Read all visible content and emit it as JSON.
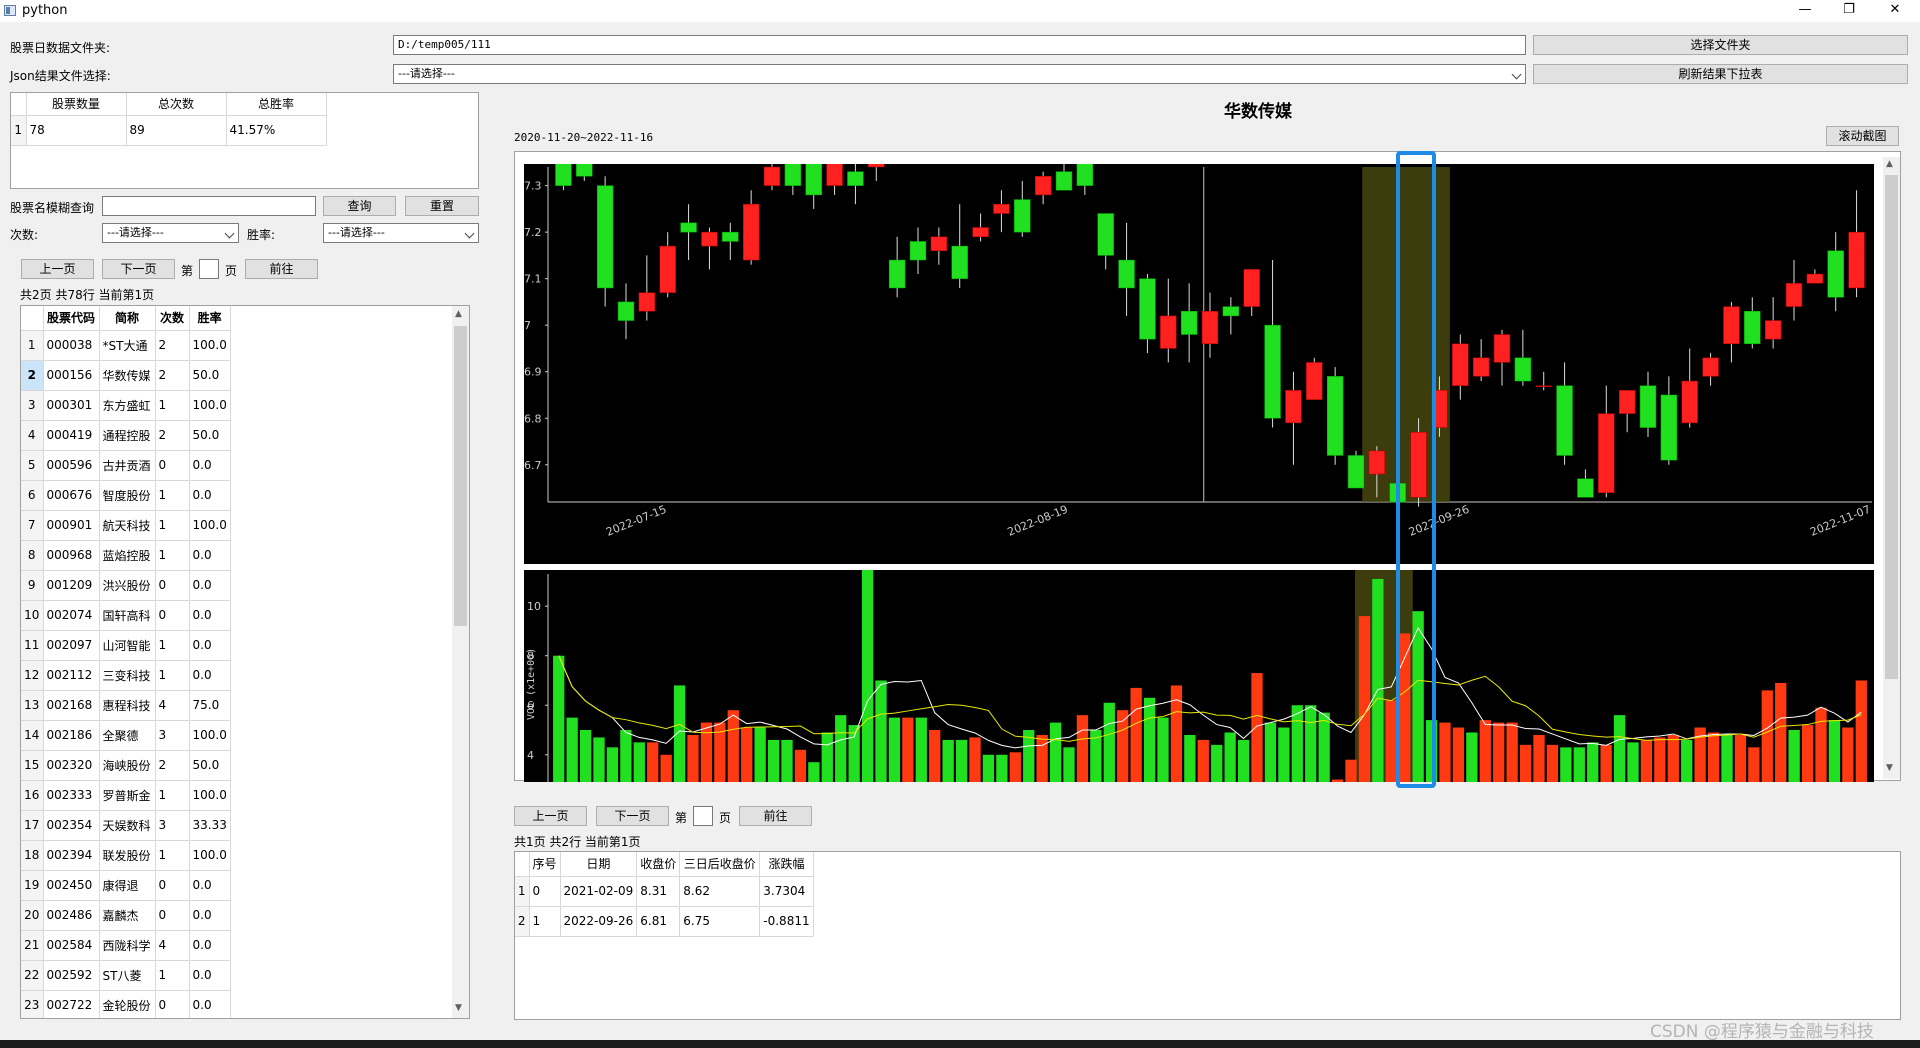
{
  "window": {
    "title": "python",
    "minimize": "—",
    "maximize": "❐",
    "close": "✕"
  },
  "folder": {
    "label": "股票日数据文件夹:",
    "value": "D:/temp005/111",
    "button": "选择文件夹"
  },
  "json": {
    "label": "Json结果文件选择:",
    "value": "---请选择---",
    "button": "刷新结果下拉表"
  },
  "summary": {
    "headers": [
      "股票数量",
      "总次数",
      "总胜率"
    ],
    "row_num": "1",
    "values": [
      "78",
      "89",
      "41.57%"
    ]
  },
  "search": {
    "label": "股票名模糊查询",
    "value": "",
    "query_button": "查询",
    "reset_button": "重置"
  },
  "filters": {
    "count_label": "次数:",
    "count_value": "---请选择---",
    "rate_label": "胜率:",
    "rate_value": "---请选择---"
  },
  "pager_left": {
    "prev": "上一页",
    "next": "下一页",
    "di": "第",
    "ye": "页",
    "go": "前往",
    "info": "共2页 共78行 当前第1页"
  },
  "stock_table": {
    "headers": [
      "股票代码",
      "简称",
      "次数",
      "胜率"
    ],
    "selected_row": 2,
    "rows": [
      [
        "1",
        "000038",
        "*ST大通",
        "2",
        "100.0"
      ],
      [
        "2",
        "000156",
        "华数传媒",
        "2",
        "50.0"
      ],
      [
        "3",
        "000301",
        "东方盛虹",
        "1",
        "100.0"
      ],
      [
        "4",
        "000419",
        "通程控股",
        "2",
        "50.0"
      ],
      [
        "5",
        "000596",
        "古井贡酒",
        "0",
        "0.0"
      ],
      [
        "6",
        "000676",
        "智度股份",
        "1",
        "0.0"
      ],
      [
        "7",
        "000901",
        "航天科技",
        "1",
        "100.0"
      ],
      [
        "8",
        "000968",
        "蓝焰控股",
        "1",
        "0.0"
      ],
      [
        "9",
        "001209",
        "洪兴股份",
        "0",
        "0.0"
      ],
      [
        "10",
        "002074",
        "国轩高科",
        "0",
        "0.0"
      ],
      [
        "11",
        "002097",
        "山河智能",
        "1",
        "0.0"
      ],
      [
        "12",
        "002112",
        "三变科技",
        "1",
        "0.0"
      ],
      [
        "13",
        "002168",
        "惠程科技",
        "4",
        "75.0"
      ],
      [
        "14",
        "002186",
        "全聚德",
        "3",
        "100.0"
      ],
      [
        "15",
        "002320",
        "海峡股份",
        "2",
        "50.0"
      ],
      [
        "16",
        "002333",
        "罗普斯金",
        "1",
        "100.0"
      ],
      [
        "17",
        "002354",
        "天娱数科",
        "3",
        "33.33"
      ],
      [
        "18",
        "002394",
        "联发股份",
        "1",
        "100.0"
      ],
      [
        "19",
        "002450",
        "康得退",
        "0",
        "0.0"
      ],
      [
        "20",
        "002486",
        "嘉麟杰",
        "0",
        "0.0"
      ],
      [
        "21",
        "002584",
        "西陇科学",
        "4",
        "0.0"
      ],
      [
        "22",
        "002592",
        "ST八菱",
        "1",
        "0.0"
      ],
      [
        "23",
        "002722",
        "金轮股份",
        "0",
        "0.0"
      ]
    ]
  },
  "chart_header": {
    "title": "华数传媒",
    "date_range": "2020-11-20~2022-11-16",
    "scroll_button": "滚动截图"
  },
  "chart_data": [
    {
      "type": "candlestick",
      "yticks": [
        "7.3",
        "7.2",
        "7.1",
        "7",
        "6.9",
        "6.8",
        "6.7"
      ],
      "ylim": [
        6.62,
        7.34
      ],
      "xticks": [
        "2022-07-15",
        "2022-08-19",
        "2022-09-26",
        "2022-11-07"
      ],
      "highlight": "2022-09-26",
      "candles_ohlc": [
        [
          7.35,
          7.3,
          7.35,
          7.29
        ],
        [
          7.35,
          7.32,
          7.36,
          7.31
        ],
        [
          7.3,
          7.08,
          7.32,
          7.04
        ],
        [
          7.05,
          7.01,
          7.09,
          6.97
        ],
        [
          7.03,
          7.07,
          7.15,
          7.01
        ],
        [
          7.07,
          7.17,
          7.2,
          7.06
        ],
        [
          7.22,
          7.2,
          7.26,
          7.14
        ],
        [
          7.17,
          7.2,
          7.21,
          7.12
        ],
        [
          7.2,
          7.18,
          7.22,
          7.14
        ],
        [
          7.14,
          7.26,
          7.29,
          7.13
        ],
        [
          7.3,
          7.34,
          7.38,
          7.29
        ],
        [
          7.35,
          7.3,
          7.38,
          7.28
        ],
        [
          7.35,
          7.28,
          7.36,
          7.25
        ],
        [
          7.3,
          7.35,
          7.4,
          7.28
        ],
        [
          7.33,
          7.3,
          7.36,
          7.26
        ],
        [
          7.34,
          7.35,
          7.39,
          7.31
        ],
        [
          7.14,
          7.08,
          7.19,
          7.06
        ],
        [
          7.18,
          7.14,
          7.21,
          7.11
        ],
        [
          7.16,
          7.19,
          7.21,
          7.13
        ],
        [
          7.17,
          7.1,
          7.26,
          7.08
        ],
        [
          7.19,
          7.21,
          7.24,
          7.18
        ],
        [
          7.24,
          7.26,
          7.29,
          7.2
        ],
        [
          7.27,
          7.2,
          7.31,
          7.19
        ],
        [
          7.28,
          7.32,
          7.33,
          7.26
        ],
        [
          7.33,
          7.29,
          7.35,
          7.29
        ],
        [
          7.36,
          7.3,
          7.38,
          7.28
        ],
        [
          7.24,
          7.15,
          7.24,
          7.12
        ],
        [
          7.14,
          7.08,
          7.22,
          7.02
        ],
        [
          7.1,
          6.97,
          7.11,
          6.94
        ],
        [
          6.95,
          7.02,
          7.1,
          6.92
        ],
        [
          7.03,
          6.98,
          7.09,
          6.92
        ],
        [
          6.96,
          7.03,
          7.07,
          6.93
        ],
        [
          7.04,
          7.02,
          7.06,
          6.98
        ],
        [
          7.04,
          7.12,
          7.12,
          7.02
        ],
        [
          7.0,
          6.8,
          7.14,
          6.78
        ],
        [
          6.79,
          6.86,
          6.9,
          6.7
        ],
        [
          6.84,
          6.92,
          6.93,
          6.84
        ],
        [
          6.89,
          6.72,
          6.91,
          6.7
        ],
        [
          6.72,
          6.65,
          6.73,
          6.65
        ],
        [
          6.68,
          6.73,
          6.74,
          6.63
        ],
        [
          6.66,
          6.62,
          6.69,
          6.62
        ],
        [
          6.63,
          6.77,
          6.8,
          6.61
        ],
        [
          6.78,
          6.86,
          6.89,
          6.76
        ],
        [
          6.87,
          6.96,
          6.98,
          6.84
        ],
        [
          6.89,
          6.93,
          6.97,
          6.88
        ],
        [
          6.92,
          6.98,
          6.99,
          6.87
        ],
        [
          6.93,
          6.88,
          6.99,
          6.87
        ],
        [
          6.87,
          6.87,
          6.9,
          6.86
        ],
        [
          6.87,
          6.72,
          6.92,
          6.7
        ],
        [
          6.67,
          6.63,
          6.69,
          6.63
        ],
        [
          6.64,
          6.81,
          6.87,
          6.63
        ],
        [
          6.81,
          6.86,
          6.86,
          6.77
        ],
        [
          6.87,
          6.78,
          6.9,
          6.76
        ],
        [
          6.85,
          6.71,
          6.89,
          6.7
        ],
        [
          6.79,
          6.88,
          6.95,
          6.78
        ],
        [
          6.89,
          6.93,
          6.94,
          6.87
        ],
        [
          6.96,
          7.04,
          7.05,
          6.92
        ],
        [
          7.03,
          6.96,
          7.06,
          6.95
        ],
        [
          6.97,
          7.01,
          7.06,
          6.95
        ],
        [
          7.04,
          7.09,
          7.14,
          7.01
        ],
        [
          7.09,
          7.11,
          7.12,
          7.09
        ],
        [
          7.16,
          7.06,
          7.2,
          7.03
        ],
        [
          7.08,
          7.2,
          7.29,
          7.06
        ]
      ]
    },
    {
      "type": "bar",
      "ylabel": "VOL (x1e+06)",
      "yticks": [
        "10",
        "8",
        "6",
        "4"
      ],
      "ylim": [
        2.9,
        11.3
      ],
      "volumes": [
        [
          8.0,
          0
        ],
        [
          5.5,
          0
        ],
        [
          5.0,
          0
        ],
        [
          4.7,
          0
        ],
        [
          4.3,
          0
        ],
        [
          5.0,
          0
        ],
        [
          4.5,
          0
        ],
        [
          4.5,
          1
        ],
        [
          4.0,
          1
        ],
        [
          6.8,
          0
        ],
        [
          4.8,
          1
        ],
        [
          5.3,
          1
        ],
        [
          5.3,
          1
        ],
        [
          5.8,
          1
        ],
        [
          5.1,
          1
        ],
        [
          5.1,
          0
        ],
        [
          4.6,
          0
        ],
        [
          4.6,
          0
        ],
        [
          4.2,
          1
        ],
        [
          3.7,
          0
        ],
        [
          4.9,
          0
        ],
        [
          5.6,
          0
        ],
        [
          5.2,
          0
        ],
        [
          11.5,
          0
        ],
        [
          7.0,
          0
        ],
        [
          5.5,
          0
        ],
        [
          5.5,
          1
        ],
        [
          5.5,
          0
        ],
        [
          5.0,
          1
        ],
        [
          4.6,
          0
        ],
        [
          4.6,
          0
        ],
        [
          4.7,
          1
        ],
        [
          4.0,
          0
        ],
        [
          4.0,
          0
        ],
        [
          4.1,
          1
        ],
        [
          5.0,
          0
        ],
        [
          4.8,
          1
        ],
        [
          5.3,
          0
        ],
        [
          4.3,
          0
        ],
        [
          5.6,
          1
        ],
        [
          5.0,
          0
        ],
        [
          6.1,
          0
        ],
        [
          5.8,
          1
        ],
        [
          6.7,
          1
        ],
        [
          6.3,
          0
        ],
        [
          5.5,
          0
        ],
        [
          6.8,
          1
        ],
        [
          4.8,
          0
        ],
        [
          4.6,
          1
        ],
        [
          4.4,
          0
        ],
        [
          4.9,
          0
        ],
        [
          4.6,
          0
        ],
        [
          7.3,
          1
        ],
        [
          5.3,
          0
        ],
        [
          5.1,
          0
        ],
        [
          6.0,
          0
        ],
        [
          6.0,
          0
        ],
        [
          5.7,
          0
        ],
        [
          3.0,
          1
        ],
        [
          3.8,
          1
        ],
        [
          9.6,
          1
        ],
        [
          11.1,
          0
        ],
        [
          6.2,
          1
        ],
        [
          8.9,
          1
        ],
        [
          9.8,
          0
        ],
        [
          5.4,
          0
        ],
        [
          5.3,
          1
        ],
        [
          5.1,
          1
        ],
        [
          4.9,
          0
        ],
        [
          5.4,
          1
        ],
        [
          5.3,
          1
        ],
        [
          5.3,
          1
        ],
        [
          4.4,
          1
        ],
        [
          4.8,
          1
        ],
        [
          4.4,
          1
        ],
        [
          4.3,
          0
        ],
        [
          4.3,
          0
        ],
        [
          4.5,
          0
        ],
        [
          4.4,
          1
        ],
        [
          5.6,
          0
        ],
        [
          4.5,
          0
        ],
        [
          4.6,
          1
        ],
        [
          4.7,
          1
        ],
        [
          4.8,
          1
        ],
        [
          4.6,
          0
        ],
        [
          5.1,
          1
        ],
        [
          4.9,
          1
        ],
        [
          4.8,
          0
        ],
        [
          4.8,
          1
        ],
        [
          4.3,
          1
        ],
        [
          6.6,
          1
        ],
        [
          6.9,
          1
        ],
        [
          5.0,
          0
        ],
        [
          5.2,
          1
        ],
        [
          5.9,
          1
        ],
        [
          5.4,
          0
        ],
        [
          5.1,
          1
        ],
        [
          7.0,
          1
        ]
      ]
    }
  ],
  "pager_right": {
    "prev": "上一页",
    "next": "下一页",
    "di": "第",
    "ye": "页",
    "go": "前往",
    "info": "共1页 共2行 当前第1页"
  },
  "trade_table": {
    "headers": [
      "序号",
      "日期",
      "收盘价",
      "三日后收盘价",
      "涨跌幅"
    ],
    "rows": [
      [
        "1",
        "0",
        "2021-02-09",
        "8.31",
        "8.62",
        "3.7304"
      ],
      [
        "2",
        "1",
        "2022-09-26",
        "6.81",
        "6.75",
        "-0.8811"
      ]
    ]
  },
  "watermark": "CSDN @程序猿与金融与科技",
  "colors": {
    "up": "#ff2020",
    "down": "#20e020",
    "highlight": "#505010",
    "focus": "#1e8ce6",
    "ma1": "#ffffff",
    "ma2": "#e8e800"
  }
}
